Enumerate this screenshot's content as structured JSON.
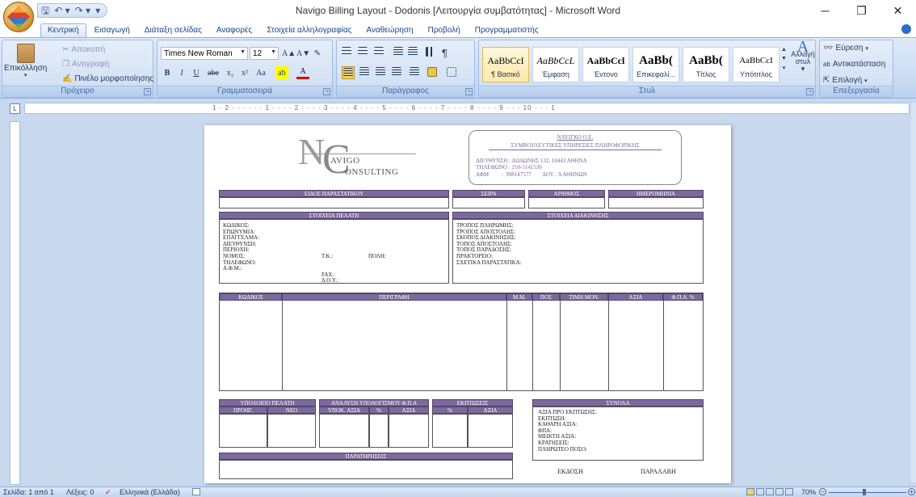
{
  "window": {
    "title": "Navigo Billing Layout - Dodonis [Λειτουργία συμβατότητας] - Microsoft Word",
    "controls": [
      "─",
      "❐",
      "✕"
    ]
  },
  "qat": {
    "save_icon": "save-icon",
    "undo": "↶ ▾",
    "redo": "↷ ▾",
    "more": "▾"
  },
  "tabs": [
    "Κεντρική",
    "Εισαγωγή",
    "Διάταξη σελίδας",
    "Αναφορές",
    "Στοιχεία αλληλογραφίας",
    "Αναθεώρηση",
    "Προβολή",
    "Προγραμματιστής"
  ],
  "ribbon": {
    "clipboard": {
      "label": "Πρόχειρο",
      "paste": "Επικόλληση",
      "paste_arrow": "▾",
      "cut": "Αποκοπή",
      "copy": "Αντιγραφή",
      "format_painter": "Πινέλο μορφοποίησης"
    },
    "font": {
      "label": "Γραμματοσειρά",
      "name": "Times New Roman",
      "size": "12",
      "grow": "A▲",
      "shrink": "A▼",
      "clear": "✎",
      "bold": "B",
      "italic": "I",
      "underline": "U",
      "strike": "abe",
      "sub": "x₂",
      "sup": "x²",
      "case": "Aa",
      "highlight": "ab",
      "color": "A"
    },
    "paragraph": {
      "label": "Παράγραφος"
    },
    "styles": {
      "label": "Στυλ",
      "items": [
        {
          "preview": "AaBbCcI",
          "name": "¶ Βασικό"
        },
        {
          "preview": "AaBbCcL",
          "name": "Έμφαση"
        },
        {
          "preview": "AaBbCcl",
          "name": "Έντονο"
        },
        {
          "preview": "AaBb(",
          "name": "Επικεφαλί..."
        },
        {
          "preview": "AaBb(",
          "name": "Τίτλος"
        },
        {
          "preview": "AaBbCcI",
          "name": "Υπότιτλος"
        }
      ],
      "change": "Αλλαγή στυλ",
      "change_arrow": "▾"
    },
    "editing": {
      "label": "Επεξεργασία",
      "find": "Εύρεση",
      "replace": "Αντικατάσταση",
      "select": "Επιλογή"
    }
  },
  "ruler": {
    "corner": "L",
    "scale": "1 · 2 · · · · · · 1 · · · · 2 · · · · 3 · · · · 4 · · · · 5 · · · · 6 · · · · 7 · · · · 8 · · · · 9 · · · 10 · · · 1"
  },
  "document": {
    "logo_line1": "AVIGO",
    "logo_line2": "ONSULTING",
    "company": {
      "name": "ΝΑΥΙΓΚΟ Ο.Ε.",
      "desc": "ΣΥΜΒΟΥΛΕΥΤΙΚΕΣ ΥΠΗΡΕΣΙΕΣ ΠΛΗΡΟΦΟΡΙΚΗΣ",
      "address": "ΔΙΕΥΘΥΝΣΗ : ΔΩΔΩΝΗΣ 132, 10443 ΑΘΗΝΑ",
      "phone": "ΤΗΛΕΦΩΝΟ : 210-5141536",
      "afm": "ΑΦΜ         :  998147577        ΔΟΥ : Α ΑΘΗΝΩΝ"
    },
    "doc_header": [
      "ΕΙΔΟΣ ΠΑΡΑΣΤΑΤΙΚΟΥ",
      "ΣΕΙΡΑ",
      "ΑΡΙΘΜΟΣ",
      "ΗΜΕΡΟΜΗΝΙΑ"
    ],
    "customer_title": "ΣΤΟΙΧΕΙΑ ΠΕΛΑΤΗ",
    "customer_fields": "ΚΩΔΙΚΟΣ:\nΕΠΩΝΥΜΙΑ:\nΕΠΑΓΓΕΛΜΑ:\nΔΙΕΥΘΥΝΣΗ:\nΠΕΡΙΟΧΗ:\nΝΟΜΟΣ:\nΤΗΛΕΦΩΝΟ:\nΑ.Φ.Μ.:",
    "customer_tk": "Τ.Κ.:",
    "customer_city": "ΠΟΛΗ:",
    "customer_fax": "FAX:",
    "customer_doy": "Δ.Ο.Υ.:",
    "shipping_title": "ΣΤΟΙΧΕΙΑ ΔΙΑΚΙΝΗΣΗΣ",
    "shipping_fields": "ΤΡΟΠΟΣ ΠΛΗΡΩΜΗΣ:\nΤΡΟΠΟΣ ΑΠΟΣΤΟΛΗΣ:\nΣΚΟΠΟΣ ΔΙΑΚΙΝΗΣΗΣ:\nΤΟΠΟΣ ΑΠΟΣΤΟΛΗΣ:\nΤΟΠΟΣ ΠΑΡΑΔΟΣΗΣ:\nΠΡΑΚΤΟΡΕΙΟ:\nΣΧΕΤΙΚΑ ΠΑΡΑΣΤΑΤΙΚΑ:",
    "items_cols": [
      "ΚΩΔΙΚΟΣ",
      "ΠΕΡΙΓΡΑΦΗ",
      "Μ.Μ.",
      "ΠΟΣ",
      "ΤΙΜΗ ΜΟΝ.",
      "ΑΞΙΑ",
      "Φ.Π.Α. %"
    ],
    "balance": {
      "title": "ΥΠΟΛΟΙΠΟ ΠΕΛΑΤΗ",
      "prev": "ΠΡΟΗΓ.",
      "new": "ΝΕΟ"
    },
    "vat": {
      "title": "ΑΝΑΛΥΣΗ ΥΠΟΛΟΓΙΣΜΟΥ Φ.Π.Α",
      "base": "ΥΠΟΚ. ΑΞΙΑ",
      "pct": "%",
      "value": "ΑΞΙΑ"
    },
    "discount": {
      "title": "ΕΚΠΤΩΣΕΙΣ",
      "pct": "%",
      "value": "ΑΞΙΑ"
    },
    "totals": {
      "title": "ΣΥΝΟΛΑ",
      "lines": "ΑΞΙΑ ΠΡΟ ΕΚΠΤΩΣΗΣ:\nΕΚΠΤΩΣΗ:\nΚΑΘΑΡΗ ΑΞΙΑ:\nΦΠΑ:\nΜΕΙΚΤΗ ΑΞΙΑ:\nΚΡΑΤΗΣΕΙΣ:\nΠΛΗΡΩΤΕΟ ΠΟΣΟ:"
    },
    "notes": "ΠΑΡΑΤΗΡΗΣΕΙΣ",
    "issue": "ΕΚΔΟΣΗ",
    "receipt": "ΠΑΡΑΛΑΒΗ"
  },
  "status": {
    "page": "Σελίδα: 1 από 1",
    "words": "Λέξεις: 0",
    "lang": "Ελληνικά (Ελλάδα)",
    "zoom": "70%"
  }
}
